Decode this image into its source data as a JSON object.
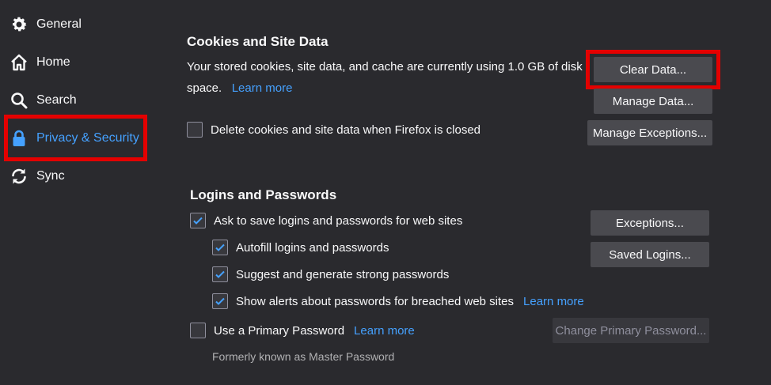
{
  "sidebar": {
    "items": [
      {
        "label": "General",
        "icon": "gear-icon"
      },
      {
        "label": "Home",
        "icon": "home-icon"
      },
      {
        "label": "Search",
        "icon": "search-icon"
      },
      {
        "label": "Privacy & Security",
        "icon": "lock-icon",
        "active": true
      },
      {
        "label": "Sync",
        "icon": "sync-icon"
      }
    ]
  },
  "cookies": {
    "title": "Cookies and Site Data",
    "desc_line1": "Your stored cookies, site data, and cache are currently using 1.0 GB of disk",
    "desc_line2": "space.",
    "learn_more": "Learn more",
    "delete_label": "Delete cookies and site data when Firefox is closed",
    "delete_checked": false,
    "clear_btn": "Clear Data...",
    "manage_btn": "Manage Data...",
    "exceptions_btn": "Manage Exceptions..."
  },
  "logins": {
    "title": "Logins and Passwords",
    "ask_label": "Ask to save logins and passwords for web sites",
    "autofill_label": "Autofill logins and passwords",
    "suggest_label": "Suggest and generate strong passwords",
    "alerts_label": "Show alerts about passwords for breached web sites",
    "alerts_learn_more": "Learn more",
    "primary_label": "Use a Primary Password",
    "primary_learn_more": "Learn more",
    "formerly": "Formerly known as Master Password",
    "exceptions_btn": "Exceptions...",
    "saved_btn": "Saved Logins...",
    "change_primary_btn": "Change Primary Password..."
  },
  "colors": {
    "background": "#2a2a2e",
    "accent": "#45a1ff",
    "button": "#4a4a4f",
    "highlight": "#e40000"
  }
}
